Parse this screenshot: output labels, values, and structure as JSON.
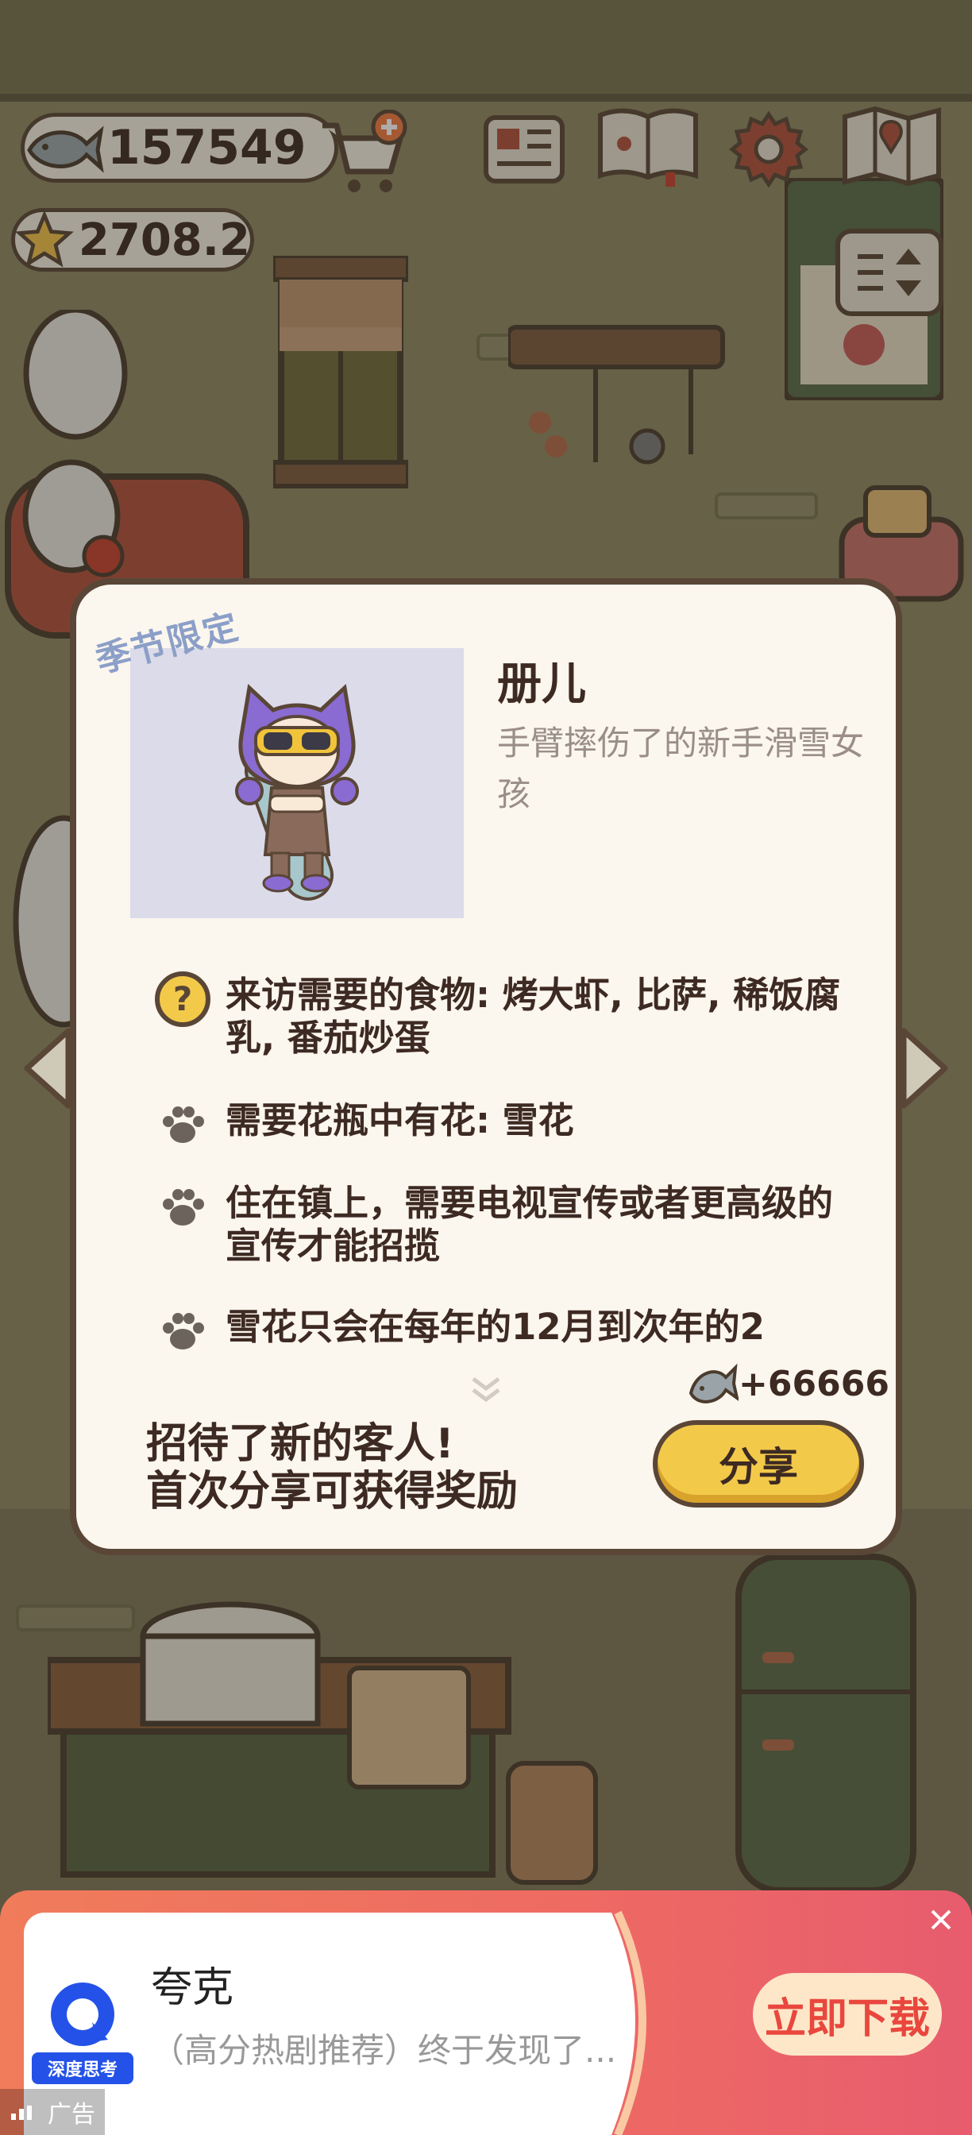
{
  "hud": {
    "fish_count": "157549",
    "star_count": "2708.2"
  },
  "dialog": {
    "season_tag": "季节限定",
    "guest_name": "册儿",
    "guest_desc": "手臂摔伤了的新手滑雪女孩",
    "requirements": [
      {
        "icon": "question-icon",
        "text": "来访需要的食物: 烤大虾, 比萨, 稀饭腐乳, 番茄炒蛋"
      },
      {
        "icon": "paw-icon",
        "text": "需要花瓶中有花: 雪花"
      },
      {
        "icon": "paw-icon",
        "text": "住在镇上，需要电视宣传或者更高级的宣传才能招揽"
      },
      {
        "icon": "paw-icon",
        "text": "雪花只会在每年的12月到次年的2"
      }
    ],
    "reward": "+66666",
    "message_line1": "招待了新的客人!",
    "message_line2": "首次分享可获得奖励",
    "share_label": "分享"
  },
  "ad": {
    "app_name": "夸克",
    "subtitle": "（高分热剧推荐）终于发现了...",
    "logo_caption": "深度思考",
    "download_label": "立即下载",
    "ad_label": "广告"
  },
  "colors": {
    "ink": "#3d2a22",
    "card_bg": "#fbf6ee",
    "share_yellow": "#f3c94a",
    "ad_red": "#ee6a63",
    "ad_button_text": "#e9473e"
  }
}
